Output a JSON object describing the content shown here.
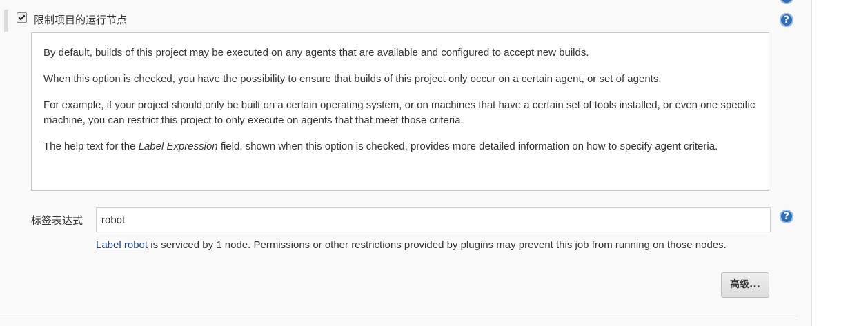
{
  "restrict_option": {
    "checked": true,
    "label": "限制项目的运行节点"
  },
  "help_text": {
    "p1": "By default, builds of this project may be executed on any agents that are available and configured to accept new builds.",
    "p2": "When this option is checked, you have the possibility to ensure that builds of this project only occur on a certain agent, or set of agents.",
    "p3": "For example, if your project should only be built on a certain operating system, or on machines that have a certain set of tools installed, or even one specific machine, you can restrict this project to only execute on agents that that meet those criteria.",
    "p4_before": "The help text for the ",
    "p4_italic": "Label Expression",
    "p4_after": " field, shown when this option is checked, provides more detailed information on how to specify agent criteria."
  },
  "label_expression": {
    "label": "标签表达式",
    "value": "robot"
  },
  "validation": {
    "link_text": "Label robot",
    "message": " is serviced by 1 node. Permissions or other restrictions provided by plugins may prevent this job from running on those nodes."
  },
  "advanced_button": {
    "label": "高级..."
  },
  "icons": {
    "help": "help-icon"
  },
  "colors": {
    "help_icon": "#2f6db5",
    "link": "#204a87",
    "background": "#f9f9f9"
  }
}
